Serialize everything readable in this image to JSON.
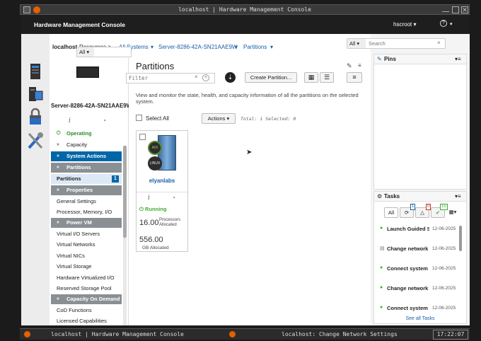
{
  "window": {
    "title": "localhost | Hardware Management Console"
  },
  "app": {
    "title": "Hardware Management Console",
    "user": "hscroot"
  },
  "breadcrumb": {
    "home": "localhost",
    "resources": "Resources >",
    "all_systems": "All Systems",
    "server": "Server-8286-42A-SN21AAE9W",
    "partitions": "Partitions"
  },
  "search": {
    "scope": "All",
    "placeholder": "Search"
  },
  "sidebar": {
    "filter_scope": "All",
    "server_name": "Server-8286-42A-SN21AAE9W",
    "status": "Operating",
    "capacity": "Capacity",
    "system_actions": "System Actions",
    "partitions_header": "Partitions",
    "partitions_item": "Partitions",
    "partitions_count": "1",
    "properties_header": "Properties",
    "general_settings": "General Settings",
    "processor_memory": "Processor, Memory, I/O",
    "powervm_header": "Power VM",
    "virtual_io_servers": "Virtual I/O Servers",
    "virtual_networks": "Virtual Networks",
    "virtual_nics": "Virtual NICs",
    "virtual_storage": "Virtual Storage",
    "hardware_virtualized_io": "Hardware Virtualized I/O",
    "reserved_storage_pool": "Reserved Storage Pool",
    "cod_header": "Capacity On Demand",
    "cod_functions": "CoD Functions",
    "licensed_capabilities": "Licensed Capabilities"
  },
  "content": {
    "title": "Partitions",
    "filter_placeholder": "Filter",
    "create_button": "Create Partition...",
    "description": "View and monitor the state, health, and capacity information of all the partitions on the selected system.",
    "select_all": "Select All",
    "actions": "Actions",
    "total": "Total: 1 Selected: 0"
  },
  "partition_card": {
    "os1": "AIX",
    "os2": "LINUX",
    "name": "elyanlabs",
    "state": "Running",
    "processors": "16.00",
    "processors_label": "Processors Allocated",
    "memory": "556.00",
    "memory_label": "GB Allocated"
  },
  "pins": {
    "title": "Pins"
  },
  "tasks": {
    "title": "Tasks",
    "filter_all": "All",
    "count_running": "1",
    "count_warning": "0",
    "count_done": "15",
    "items": [
      {
        "name": "Launch Guided S",
        "date": "12-06-2025"
      },
      {
        "name": "Change network",
        "date": "12-06-2025"
      },
      {
        "name": "Connect system",
        "date": "12-06-2025"
      },
      {
        "name": "Change network",
        "date": "12-06-2025"
      },
      {
        "name": "Connect system",
        "date": "12-06-2025"
      }
    ],
    "see_all": "See all Tasks"
  },
  "taskbar": {
    "item1": "localhost | Hardware Management Console",
    "item2": "localhost: Change Network Settings",
    "clock": "17:22:07"
  },
  "colors": {
    "accent": "#0066a8",
    "header": "#1e1e1e",
    "ok": "#3cae2c"
  }
}
